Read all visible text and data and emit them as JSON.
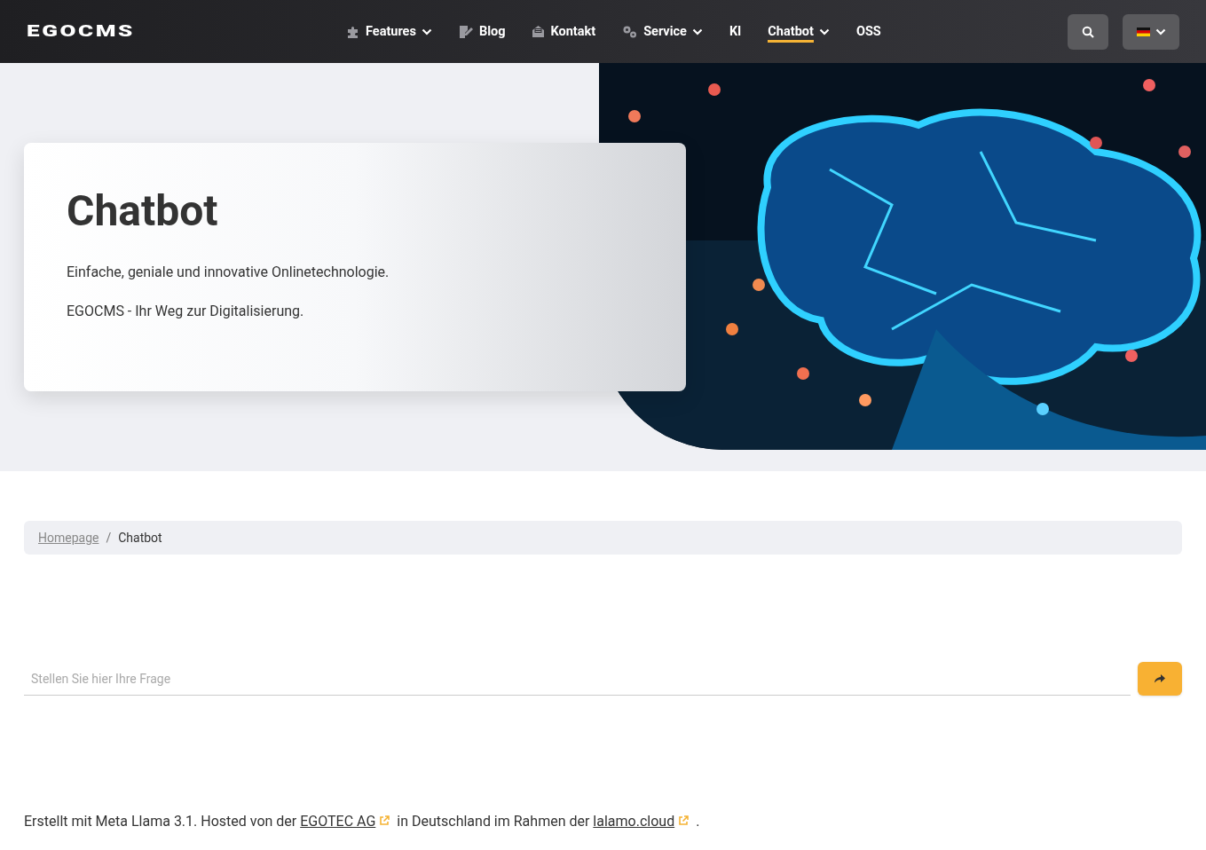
{
  "header": {
    "logo": "EGOCMS",
    "nav": [
      {
        "label": "Features",
        "dropdown": true,
        "selected": false
      },
      {
        "label": "Blog",
        "dropdown": false,
        "selected": false
      },
      {
        "label": "Kontakt",
        "dropdown": false,
        "selected": false
      },
      {
        "label": "Service",
        "dropdown": true,
        "selected": false
      },
      {
        "label": "KI",
        "dropdown": false,
        "selected": false
      },
      {
        "label": "Chatbot",
        "dropdown": true,
        "selected": true
      },
      {
        "label": "OSS",
        "dropdown": false,
        "selected": false
      }
    ]
  },
  "hero": {
    "title": "Chatbot",
    "lines": [
      "Einfache, geniale und innovative Onlinetechnologie.",
      "EGOCMS - Ihr Weg zur Digitalisierung."
    ]
  },
  "breadcrumb": {
    "separator": "/",
    "items": [
      {
        "label": "Homepage",
        "link": true
      },
      {
        "label": "Chatbot",
        "link": false
      }
    ]
  },
  "chat": {
    "placeholder": "Stellen Sie hier Ihre Frage"
  },
  "footer": {
    "parts": [
      {
        "kind": "text",
        "text": "Erstellt mit Meta Llama 3.1. Hosted von der "
      },
      {
        "kind": "link",
        "text": "EGOTEC AG"
      },
      {
        "kind": "text",
        "text": " in Deutschland im Rahmen der "
      },
      {
        "kind": "link",
        "text": "lalamo.cloud"
      },
      {
        "kind": "text",
        "text": " ."
      }
    ]
  }
}
